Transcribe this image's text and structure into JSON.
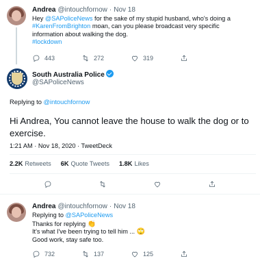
{
  "tweet1": {
    "name": "Andrea",
    "handle": "@intouchfornow",
    "sep": "·",
    "date": "Nov 18",
    "line1_pre": "Hey ",
    "line1_mention": "@SAPoliceNews",
    "line1_post": " for the sake of my stupid husband, who's doing a",
    "line2_hashtag": "#KarenFromBrighton",
    "line2_post": " moan, can you please broadcast very specific",
    "line3": "information about walking the dog.",
    "line4_hashtag": "#lockdown",
    "reply_count": "443",
    "retweet_count": "272",
    "like_count": "319"
  },
  "main": {
    "name": "South Australia Police",
    "handle": "@SAPoliceNews",
    "replying_label": "Replying to ",
    "replying_handle": "@intouchfornow",
    "text": "Hi Andrea, You cannot leave the house to walk the dog or to exercise.",
    "timestamp": "1:21 AM · Nov 18, 2020 · TweetDeck",
    "retweets_value": "2.2K",
    "retweets_label": "Retweets",
    "quotes_value": "6K",
    "quotes_label": "Quote Tweets",
    "likes_value": "1.8K",
    "likes_label": "Likes"
  },
  "tweet3": {
    "name": "Andrea",
    "handle": "@intouchfornow",
    "sep": "·",
    "date": "Nov 18",
    "replying_label": "Replying to ",
    "replying_handle": "@SAPoliceNews",
    "line1": "Thanks for replying ",
    "line1_emoji": "👏",
    "line2": "It's what I've been trying to tell him ... ",
    "line2_emoji": "🙄",
    "line3": "Good work, stay safe too.",
    "reply_count": "732",
    "retweet_count": "137",
    "like_count": "125"
  },
  "icons": {
    "reply": "reply-icon",
    "retweet": "retweet-icon",
    "like": "heart-icon",
    "share": "share-icon",
    "verified": "verified-badge-icon"
  },
  "colors": {
    "accent": "#1d9bf0",
    "text": "#0f1419",
    "muted": "#536471",
    "divider": "#eff3f4"
  }
}
